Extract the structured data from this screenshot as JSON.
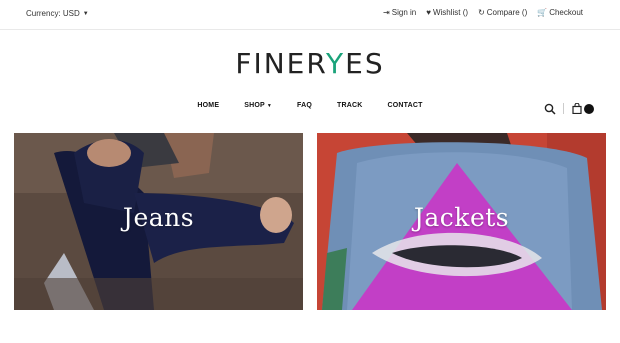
{
  "topbar": {
    "currency": "Currency: USD",
    "links": [
      {
        "label": "Sign in",
        "icon": "sign-in-icon"
      },
      {
        "label": "Wishlist ()",
        "icon": "heart-icon"
      },
      {
        "label": "Compare ()",
        "icon": "compare-icon"
      },
      {
        "label": "Checkout",
        "icon": "cart-icon"
      }
    ]
  },
  "brand": {
    "prefix": "FINER",
    "accent": "Y",
    "suffix": "ES",
    "accent_color": "#1aa37a"
  },
  "nav": {
    "home": "HOME",
    "shop": "SHOP",
    "faq": "FAQ",
    "track": "TRACK",
    "contact": "CONTACT"
  },
  "categories": {
    "jeans": "Jeans",
    "jackets": "Jackets"
  }
}
